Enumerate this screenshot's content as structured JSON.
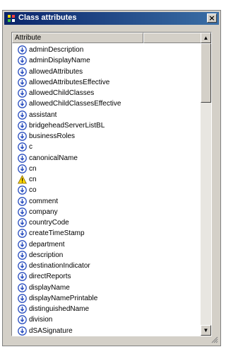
{
  "window": {
    "title": "Class attributes",
    "close_label": "×"
  },
  "list": {
    "column_header": "Attribute",
    "items": [
      {
        "label": "adminDescription",
        "icon": "attribute-icon"
      },
      {
        "label": "adminDisplayName",
        "icon": "attribute-icon"
      },
      {
        "label": "allowedAttributes",
        "icon": "attribute-icon"
      },
      {
        "label": "allowedAttributesEffective",
        "icon": "attribute-icon"
      },
      {
        "label": "allowedChildClasses",
        "icon": "attribute-icon"
      },
      {
        "label": "allowedChildClassesEffective",
        "icon": "attribute-icon"
      },
      {
        "label": "assistant",
        "icon": "attribute-icon"
      },
      {
        "label": "bridgeheadServerListBL",
        "icon": "attribute-icon"
      },
      {
        "label": "businessRoles",
        "icon": "attribute-icon"
      },
      {
        "label": "c",
        "icon": "attribute-icon"
      },
      {
        "label": "canonicalName",
        "icon": "attribute-icon"
      },
      {
        "label": "cn",
        "icon": "attribute-icon"
      },
      {
        "label": "cn",
        "icon": "warning-icon"
      },
      {
        "label": "co",
        "icon": "attribute-icon"
      },
      {
        "label": "comment",
        "icon": "attribute-icon"
      },
      {
        "label": "company",
        "icon": "attribute-icon"
      },
      {
        "label": "countryCode",
        "icon": "attribute-icon"
      },
      {
        "label": "createTimeStamp",
        "icon": "attribute-icon"
      },
      {
        "label": "department",
        "icon": "attribute-icon"
      },
      {
        "label": "description",
        "icon": "attribute-icon"
      },
      {
        "label": "destinationIndicator",
        "icon": "attribute-icon"
      },
      {
        "label": "directReports",
        "icon": "attribute-icon"
      },
      {
        "label": "displayName",
        "icon": "attribute-icon"
      },
      {
        "label": "displayNamePrintable",
        "icon": "attribute-icon"
      },
      {
        "label": "distinguishedName",
        "icon": "attribute-icon"
      },
      {
        "label": "division",
        "icon": "attribute-icon"
      },
      {
        "label": "dSASignature",
        "icon": "attribute-icon"
      }
    ]
  },
  "scrollbar": {
    "up": "▲",
    "down": "▼"
  },
  "colors": {
    "title_bar_start": "#0a246a",
    "title_bar_end": "#3a6ea5",
    "dialog_bg": "#d4d0c8",
    "icon_blue": "#2a4fc0",
    "warning_yellow": "#ffd800"
  }
}
